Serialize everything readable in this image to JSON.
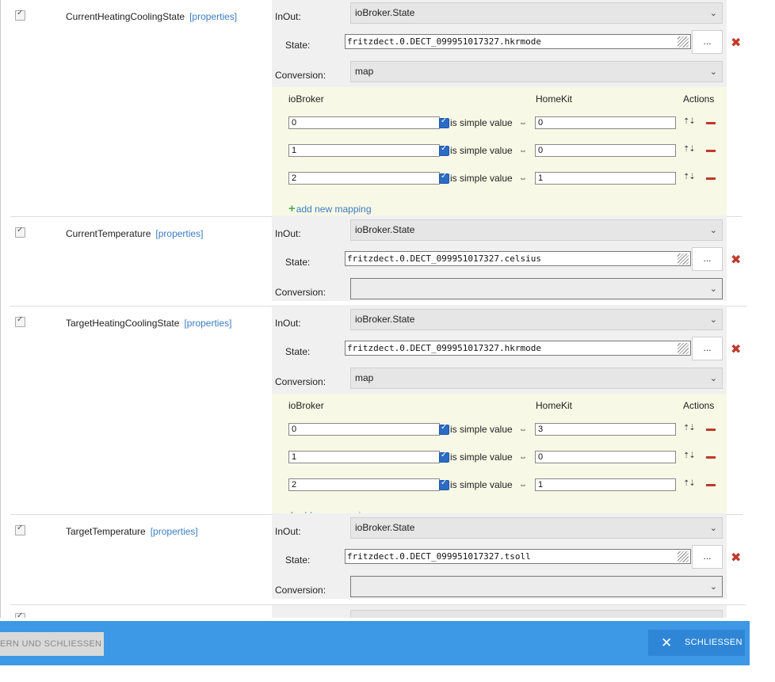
{
  "colors": {
    "footer": "#3d98e6",
    "link": "#3a7dc2",
    "delete": "#c0392b",
    "add": "#4caf50",
    "checkbox": "#2b6cc4"
  },
  "labels": {
    "properties": "[properties]",
    "inout": "InOut:",
    "state": "State:",
    "conversion": "Conversion:",
    "iobroker_col": "ioBroker",
    "homekit_col": "HomeKit",
    "actions_col": "Actions",
    "simple_value": "is simple value",
    "map_arrow": "⇔",
    "add_mapping": "add new mapping",
    "dots": "...",
    "move_icons": "⇡⇣"
  },
  "characteristics": [
    {
      "name": "CurrentHeatingCoolingState",
      "inout": "ioBroker.State",
      "state": "fritzdect.0.DECT_099951017327.hkrmode",
      "conversion": "map",
      "mappings": [
        {
          "iobroker": "0",
          "homekit": "0"
        },
        {
          "iobroker": "1",
          "homekit": "0"
        },
        {
          "iobroker": "2",
          "homekit": "1"
        }
      ]
    },
    {
      "name": "CurrentTemperature",
      "inout": "ioBroker.State",
      "state": "fritzdect.0.DECT_099951017327.celsius",
      "conversion": ""
    },
    {
      "name": "TargetHeatingCoolingState",
      "inout": "ioBroker.State",
      "state": "fritzdect.0.DECT_099951017327.hkrmode",
      "conversion": "map",
      "mappings": [
        {
          "iobroker": "0",
          "homekit": "3"
        },
        {
          "iobroker": "1",
          "homekit": "0"
        },
        {
          "iobroker": "2",
          "homekit": "1"
        }
      ]
    },
    {
      "name": "TargetTemperature",
      "inout": "ioBroker.State",
      "state": "fritzdect.0.DECT_099951017327.tsoll",
      "conversion": ""
    }
  ],
  "footer": {
    "save_close_label": "ERN UND SCHLIESSEN",
    "close_label": "SCHLIESSEN"
  }
}
